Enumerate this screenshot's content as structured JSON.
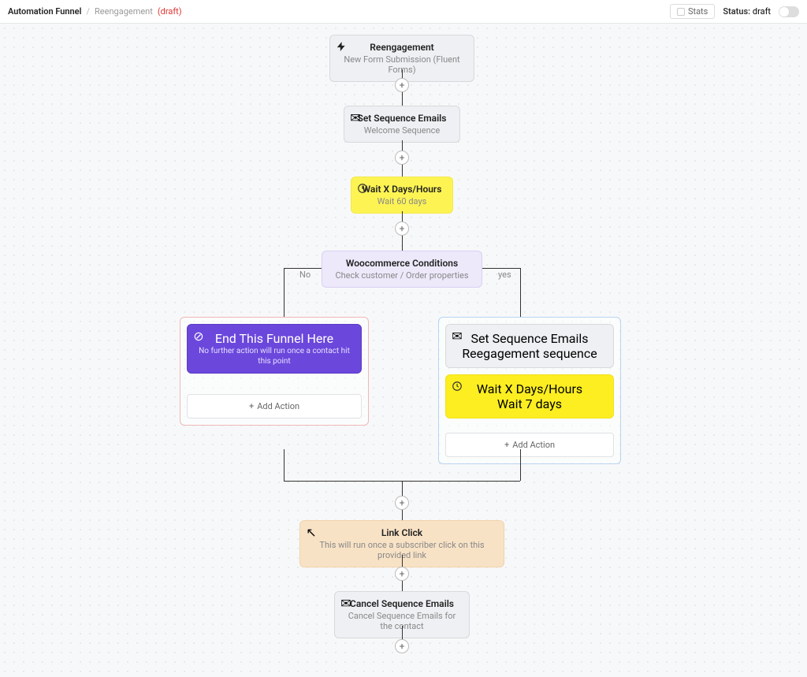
{
  "header": {
    "breadcrumb_root": "Automation Funnel",
    "breadcrumb_sep": "/",
    "funnel_name": "Reengagement",
    "draft_tag": "(draft)",
    "stats_label": "Stats",
    "status_prefix": "Status:",
    "status_value": "draft"
  },
  "trigger": {
    "title": "Reengagement",
    "sub": "New Form Submission (Fluent Forms)"
  },
  "seq1": {
    "title": "Set Sequence Emails",
    "sub": "Welcome Sequence"
  },
  "wait1": {
    "title": "Wait X Days/Hours",
    "sub": "Wait 60 days"
  },
  "cond": {
    "title": "Woocommerce Conditions",
    "sub": "Check customer / Order properties"
  },
  "labels": {
    "no": "No",
    "yes": "yes"
  },
  "no_branch": {
    "end_title": "End This Funnel Here",
    "end_sub": "No further action will run once a contact hit this point",
    "add": "Add Action"
  },
  "yes_branch": {
    "seq_title": "Set Sequence Emails",
    "seq_sub": "Reegagement sequence",
    "wait_title": "Wait X Days/Hours",
    "wait_sub": "Wait 7 days",
    "add": "Add Action"
  },
  "linkclick": {
    "title": "Link Click",
    "sub": "This will run once a subscriber click on this provided link"
  },
  "cancel": {
    "title": "Cancel Sequence Emails",
    "sub": "Cancel Sequence Emails for the contact"
  }
}
